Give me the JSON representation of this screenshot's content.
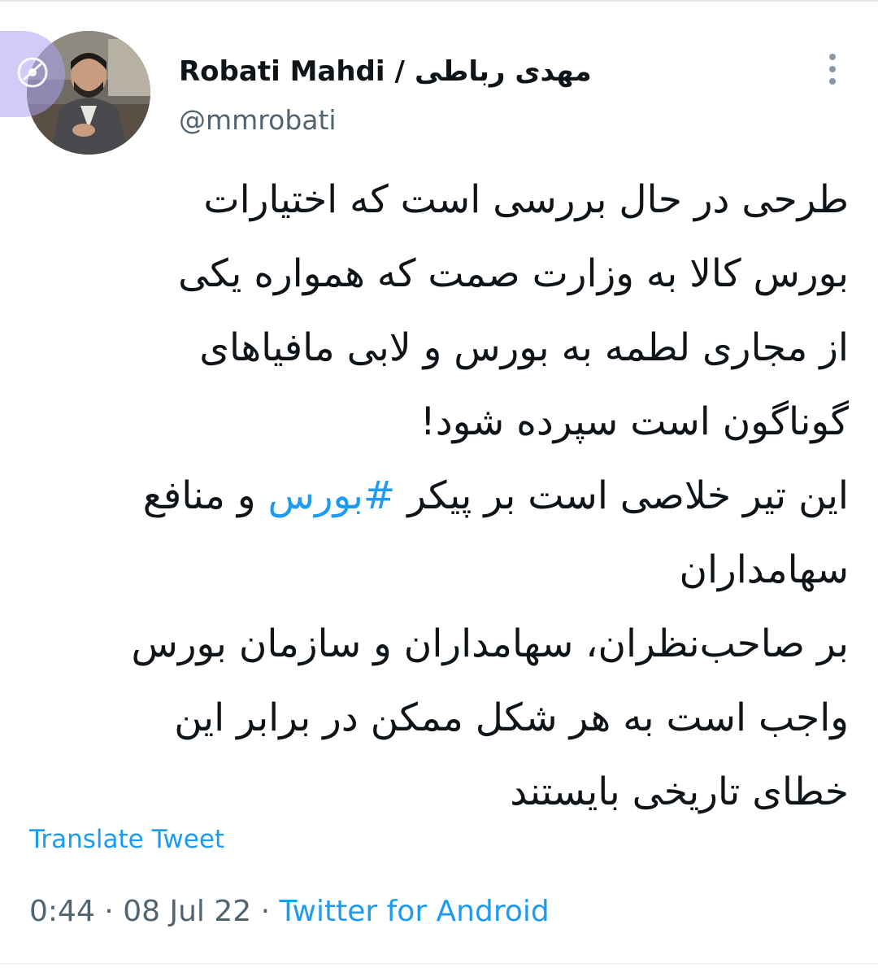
{
  "user": {
    "display_name_en": "Robati Mahdi",
    "separator": "/",
    "display_name_fa": "مهدی رباطی",
    "handle": "@mmrobati"
  },
  "tweet": {
    "lines": [
      "طرحی در حال بررسی است که اختیارات",
      "بورس کالا به وزارت صمت که همواره یکی",
      "از مجاری لطمه به بورس و لابی مافیاهای",
      "گوناگون است سپرده شود!"
    ],
    "line5_before": "این تیر خلاصی است بر پیکر ",
    "hashtag": "#بورس",
    "line5_after": " و منافع",
    "lines_rest": [
      "سهامداران",
      "بر صاحب‌نظران، سهامداران و سازمان بورس",
      "واجب است به هر شکل ممکن در برابر این",
      "خطای تاریخی بایستند"
    ]
  },
  "translate_label": "Translate Tweet",
  "meta": {
    "time": "0:44",
    "dot1": "·",
    "date": "08 Jul 22",
    "dot2": "·",
    "source": "Twitter for Android"
  },
  "colors": {
    "link": "#1d9bf0",
    "secondary": "#536471",
    "text": "#0f1419"
  },
  "icons": {
    "more": "more-vertical-icon",
    "overlay": "accessibility-badge-icon"
  }
}
